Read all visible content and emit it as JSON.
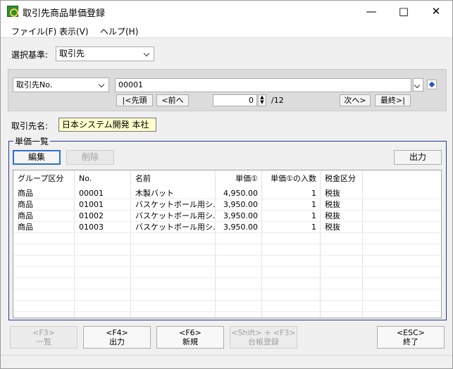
{
  "window": {
    "title": "取引先商品単価登録"
  },
  "menu": [
    {
      "label": "ファイル(F)"
    },
    {
      "label": "表示(V)"
    },
    {
      "label": "ヘルプ(H)"
    }
  ],
  "criteria": {
    "label": "選択基準:",
    "value": "取引先"
  },
  "search": {
    "field": "取引先No.",
    "value": "00001",
    "first": "|<先頭",
    "prev": "<前へ",
    "position": "0",
    "total": "/12",
    "next": "次へ>",
    "last": "最終>|"
  },
  "customer": {
    "label": "取引先名:",
    "value": "日本システム開発 本社"
  },
  "unit_list": {
    "title": "単価一覧",
    "edit": "編集",
    "delete": "削除",
    "output": "出力",
    "columns": [
      "グループ区分",
      "No.",
      "名前",
      "単価①",
      "単価①の入数",
      "税金区分"
    ],
    "rows": [
      [
        "商品",
        "00001",
        "木製バット",
        "4,950.00",
        "1",
        "税抜"
      ],
      [
        "商品",
        "01001",
        "バスケットボール用シ…",
        "3,950.00",
        "1",
        "税抜"
      ],
      [
        "商品",
        "01002",
        "バスケットボール用シ…",
        "3,950.00",
        "1",
        "税抜"
      ],
      [
        "商品",
        "01003",
        "バスケットボール用シ…",
        "3,950.00",
        "1",
        "税抜"
      ]
    ]
  },
  "function_keys": [
    {
      "key": "<F3>",
      "label": "一覧"
    },
    {
      "key": "<F4>",
      "label": "出力"
    },
    {
      "key": "<F6>",
      "label": "新規"
    },
    {
      "key": "<Shift> + <F3>",
      "label": "台帳登録"
    },
    {
      "key": "<ESC>",
      "label": "終了"
    }
  ]
}
